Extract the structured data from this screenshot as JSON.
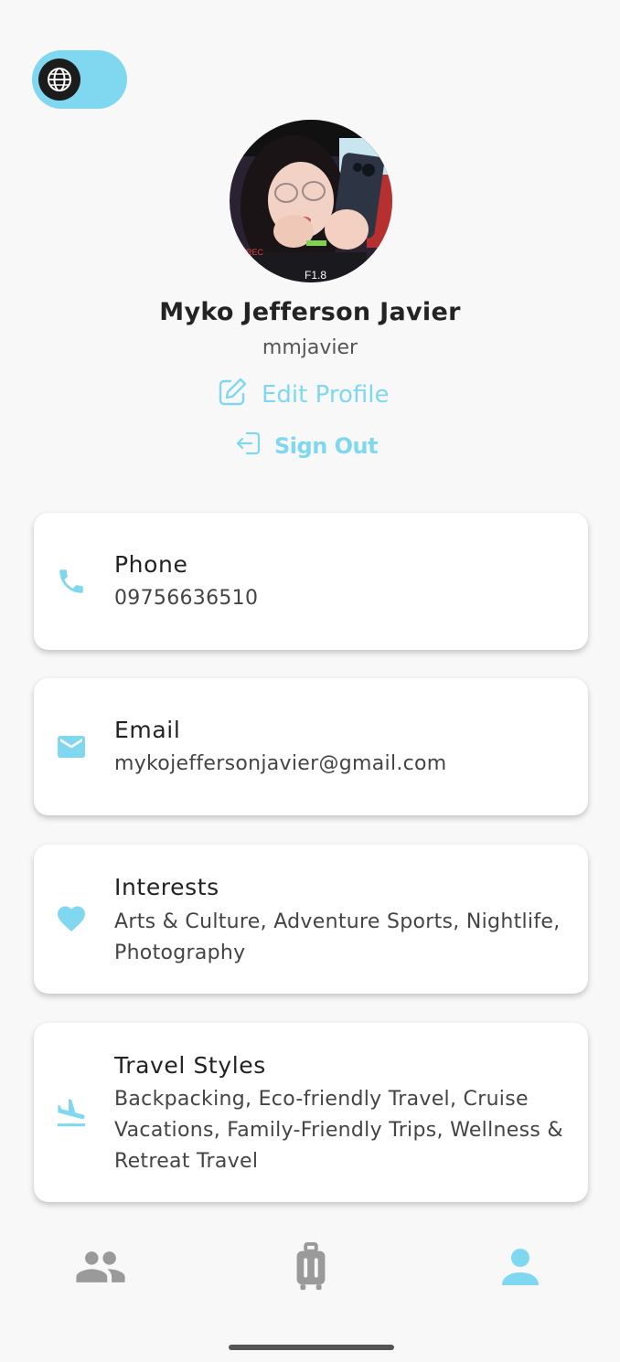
{
  "header": {
    "language_toggle_icon": "globe-icon"
  },
  "profile": {
    "name": "Myko Jefferson Javier",
    "username": "mmjavier",
    "edit_label": "Edit Profile",
    "sign_out_label": "Sign Out"
  },
  "cards": {
    "phone": {
      "icon": "phone-icon",
      "title": "Phone",
      "value": "09756636510"
    },
    "email": {
      "icon": "email-icon",
      "title": "Email",
      "value": "mykojeffersonjavier@gmail.com"
    },
    "interests": {
      "icon": "heart-icon",
      "title": "Interests",
      "value": "Arts & Culture, Adventure Sports, Nightlife, Photography"
    },
    "travel_styles": {
      "icon": "airplane-landing-icon",
      "title": "Travel Styles",
      "value": "Backpacking, Eco-friendly Travel, Cruise Vacations, Family-Friendly Trips, Wellness & Retreat Travel"
    }
  },
  "bottom_nav": {
    "items": [
      {
        "icon": "people-icon",
        "active": false
      },
      {
        "icon": "luggage-icon",
        "active": false
      },
      {
        "icon": "person-icon",
        "active": true
      }
    ]
  },
  "colors": {
    "accent": "#7fd8f0",
    "background": "#f8f8f9",
    "nav_inactive": "#9a9a9a",
    "text_primary": "#222222"
  }
}
